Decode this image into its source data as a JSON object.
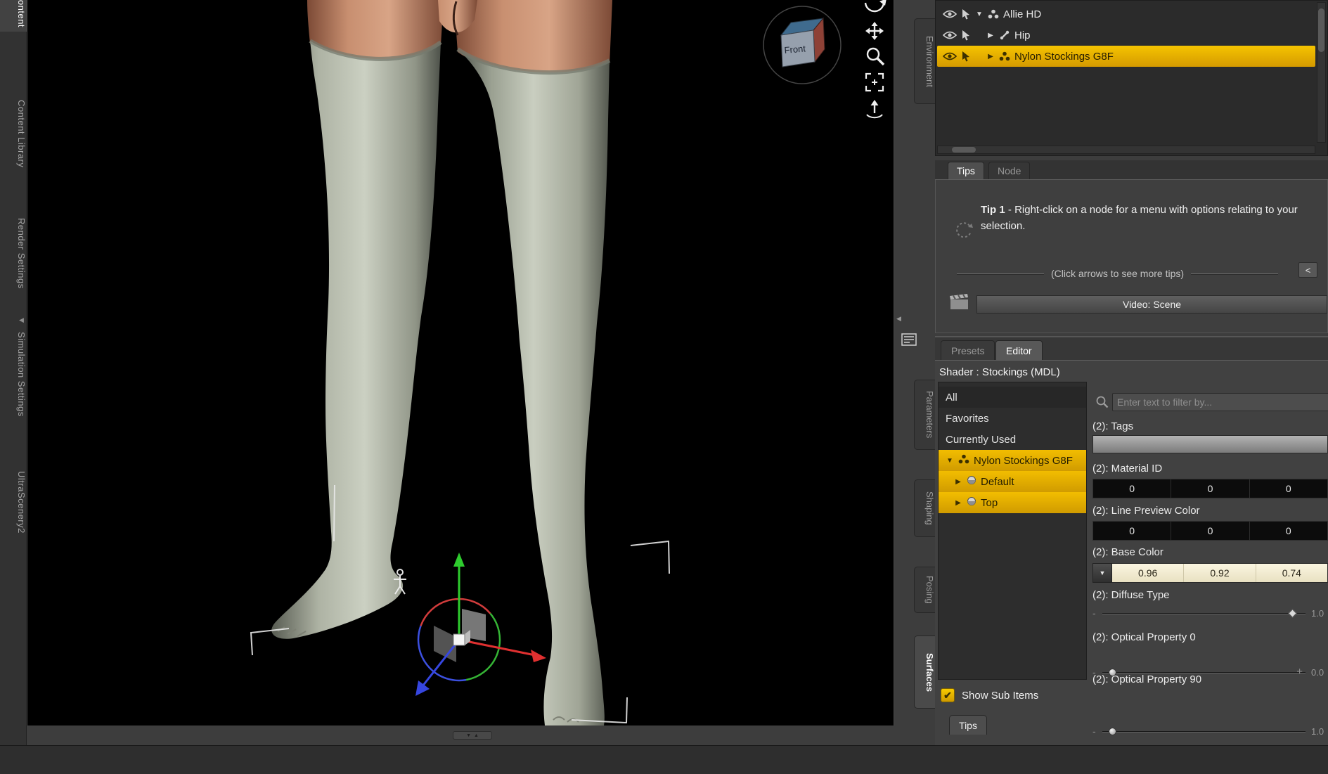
{
  "colors": {
    "selection_yellow": "#edb200",
    "viewport_bg": "#000000",
    "panel_bg": "#3d3d3d"
  },
  "icons": {
    "collapse_arrow": "▼",
    "expand_arrow": "▶",
    "dropdown_arrow": "▼",
    "checkmark": "✔",
    "minus": "-",
    "plus": "+",
    "panel_collapse_arrow": "◀",
    "splitter_down": "▼",
    "splitter_up": "▲"
  },
  "left_dock": {
    "tabs": [
      {
        "label": "Content",
        "active": true
      },
      {
        "label": "Content Library",
        "active": false
      },
      {
        "label": "Render Settings",
        "active": false
      },
      {
        "label": "Simulation Settings",
        "active": false
      },
      {
        "label": "UltraScenery2",
        "active": false
      }
    ]
  },
  "viewport": {
    "view_cube_front_label": "Front"
  },
  "right_dock_tabs": {
    "environment": "Environment",
    "parameters": "Parameters",
    "shaping": "Shaping",
    "posing": "Posing",
    "surfaces": "Surfaces"
  },
  "scene_pane": {
    "nodes": [
      {
        "label": "Allie HD",
        "expanded": true,
        "selected": false
      },
      {
        "label": "Hip",
        "expanded": false,
        "selected": false
      },
      {
        "label": "Nylon Stockings G8F",
        "expanded": false,
        "selected": true
      }
    ]
  },
  "tips_pane": {
    "tab_tips": "Tips",
    "tab_node": "Node",
    "tip_title": "Tip 1",
    "tip_body": " - Right-click on a node for a menu with options relating to your selection.",
    "more_hint": "(Click arrows to see more tips)",
    "prev_arrow": "<",
    "video_button": "Video: Scene"
  },
  "editor_pane": {
    "tab_presets": "Presets",
    "tab_editor": "Editor",
    "shader_label": "Shader :  Stockings (MDL)",
    "list": {
      "all": "All",
      "favorites": "Favorites",
      "currently_used": "Currently Used",
      "root": "Nylon Stockings G8F",
      "child1": "Default",
      "child2": "Top"
    },
    "filter_placeholder": "Enter text to filter by...",
    "props": {
      "tags_label": "(2): Tags",
      "material_id_label": "(2): Material ID",
      "material_id_values": [
        "0",
        "0",
        "0"
      ],
      "line_preview_label": "(2): Line Preview Color",
      "line_preview_values": [
        "0",
        "0",
        "0"
      ],
      "base_color_label": "(2): Base Color",
      "base_color_values": [
        "0.96",
        "0.92",
        "0.74"
      ],
      "diffuse_label": "(2): Diffuse Type",
      "diffuse_value": "1.0",
      "op0_label": "(2): Optical Property 0",
      "op0_value": "0.0",
      "op90_label": "(2): Optical Property 90",
      "op90_value": "1.0"
    },
    "show_sub_items": "Show Sub Items",
    "bottom_tab": "Tips"
  }
}
